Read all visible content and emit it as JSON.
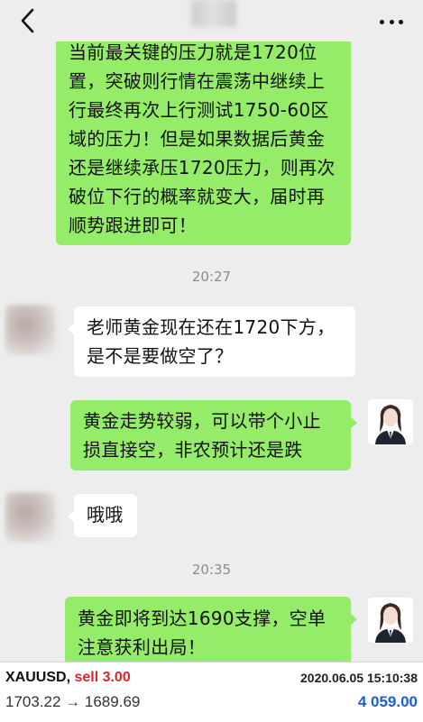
{
  "header": {
    "back_icon": "chevron-left-icon",
    "more_icon": "more-dots-icon"
  },
  "messages": [
    {
      "side": "out",
      "lines": [
        "当前最关键的压力就是1720位",
        "置，突破则行情在震荡中继续上",
        "行最终再次上行测试1750-60区",
        "域的压力！但是如果数据后黄金",
        "还是继续承压1720压力，则再次",
        "破位下行的概率就变大，届时再",
        "顺势跟进即可！"
      ]
    },
    {
      "type": "time",
      "text": "20:27"
    },
    {
      "side": "in",
      "lines": [
        "老师黄金现在还在1720下方，",
        "是不是要做空了？"
      ]
    },
    {
      "side": "out",
      "lines": [
        "黄金走势较弱，可以带个小止",
        "损直接空，非农预计还是跌"
      ]
    },
    {
      "side": "in",
      "lines": [
        "哦哦"
      ]
    },
    {
      "type": "time",
      "text": "20:35"
    },
    {
      "side": "out",
      "lines": [
        "黄金即将到达1690支撑，空单",
        "注意获利出局！"
      ]
    }
  ],
  "trade": {
    "symbol": "XAUUSD",
    "separator": ", ",
    "side": "sell 3.00",
    "datetime": "2020.06.05 15:10:38",
    "prices": "1703.22 → 1689.69",
    "profit": "4 059.00"
  },
  "colors": {
    "background": "#ededed",
    "bubble_out": "#95ec69",
    "bubble_in": "#ffffff",
    "sell": "#d9262b",
    "profit": "#1a5fd6"
  }
}
